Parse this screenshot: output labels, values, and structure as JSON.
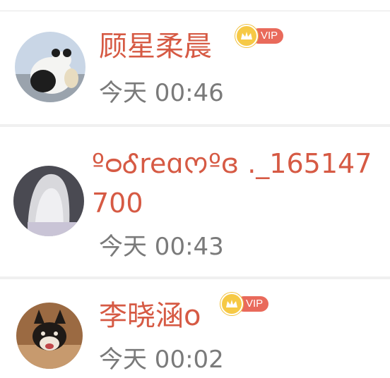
{
  "list": {
    "items": [
      {
        "name": "顾星柔晨",
        "vip_label": "VIP",
        "time": "今天 00:46",
        "avatar_icon": "panda-avatar"
      },
      {
        "name": "ºᴑᎴreɑᰔºɞ ._165147700",
        "time": "今天 00:43",
        "avatar_icon": "silver-hair-avatar"
      },
      {
        "name": "李晓涵o",
        "vip_label": "VIP",
        "time": "今天 00:02",
        "avatar_icon": "shiba-dog-avatar"
      }
    ]
  },
  "colors": {
    "name": "#d65a44",
    "time": "#7a7a7a",
    "vip_tag": "#e96a5b",
    "crown": "#f6c945"
  }
}
